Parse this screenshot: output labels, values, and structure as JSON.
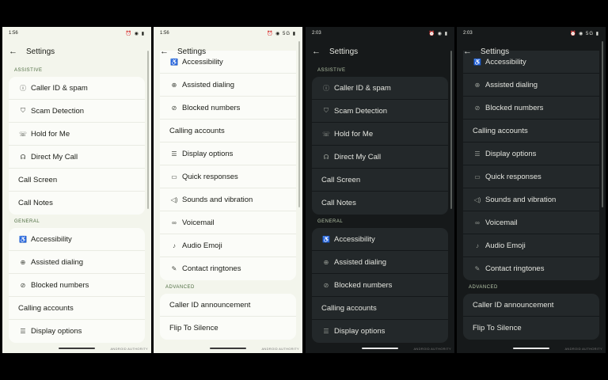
{
  "screens": [
    {
      "theme": "light",
      "time": "1:56",
      "status_icons": "⏰ ◉ ▮",
      "title": "Settings",
      "sections": [
        {
          "header": "ASSISTIVE",
          "items": [
            {
              "label": "Caller ID & spam",
              "icon": "info-circle-icon",
              "glyph": "ⓘ"
            },
            {
              "label": "Scam Detection",
              "icon": "shield-icon",
              "glyph": "⛉"
            },
            {
              "label": "Hold for Me",
              "icon": "phone-hold-icon",
              "glyph": "☏"
            },
            {
              "label": "Direct My Call",
              "icon": "direct-call-icon",
              "glyph": "☊"
            },
            {
              "label": "Call Screen",
              "icon": "",
              "glyph": ""
            },
            {
              "label": "Call Notes",
              "icon": "",
              "glyph": ""
            }
          ]
        },
        {
          "header": "GENERAL",
          "items": [
            {
              "label": "Accessibility",
              "icon": "accessibility-icon",
              "glyph": "♿"
            },
            {
              "label": "Assisted dialing",
              "icon": "globe-phone-icon",
              "glyph": "⊕"
            },
            {
              "label": "Blocked numbers",
              "icon": "block-icon",
              "glyph": "⊘"
            },
            {
              "label": "Calling accounts",
              "icon": "",
              "glyph": ""
            },
            {
              "label": "Display options",
              "icon": "list-icon",
              "glyph": "☰"
            }
          ]
        }
      ]
    },
    {
      "theme": "light",
      "time": "1:56",
      "status_icons": "⏰ ◉ 5G ▮",
      "title": "Settings",
      "sections": [
        {
          "header": "",
          "items": [
            {
              "label": "Accessibility",
              "icon": "accessibility-icon",
              "glyph": "♿"
            },
            {
              "label": "Assisted dialing",
              "icon": "globe-phone-icon",
              "glyph": "⊕"
            },
            {
              "label": "Blocked numbers",
              "icon": "block-icon",
              "glyph": "⊘"
            },
            {
              "label": "Calling accounts",
              "icon": "",
              "glyph": ""
            },
            {
              "label": "Display options",
              "icon": "list-icon",
              "glyph": "☰"
            },
            {
              "label": "Quick responses",
              "icon": "message-icon",
              "glyph": "▭"
            },
            {
              "label": "Sounds and vibration",
              "icon": "speaker-icon",
              "glyph": "◁)"
            },
            {
              "label": "Voicemail",
              "icon": "voicemail-icon",
              "glyph": "∞"
            },
            {
              "label": "Audio Emoji",
              "icon": "music-note-icon",
              "glyph": "♪"
            },
            {
              "label": "Contact ringtones",
              "icon": "contact-ringtone-icon",
              "glyph": "✎"
            }
          ]
        },
        {
          "header": "ADVANCED",
          "items": [
            {
              "label": "Caller ID announcement",
              "icon": "",
              "glyph": ""
            },
            {
              "label": "Flip To Silence",
              "icon": "",
              "glyph": ""
            }
          ]
        }
      ]
    },
    {
      "theme": "dark",
      "time": "2:03",
      "status_icons": "⏰ ◉ ▮",
      "title": "Settings",
      "sections": [
        {
          "header": "ASSISTIVE",
          "items": [
            {
              "label": "Caller ID & spam",
              "icon": "info-circle-icon",
              "glyph": "ⓘ"
            },
            {
              "label": "Scam Detection",
              "icon": "shield-icon",
              "glyph": "⛉"
            },
            {
              "label": "Hold for Me",
              "icon": "phone-hold-icon",
              "glyph": "☏"
            },
            {
              "label": "Direct My Call",
              "icon": "direct-call-icon",
              "glyph": "☊"
            },
            {
              "label": "Call Screen",
              "icon": "",
              "glyph": ""
            },
            {
              "label": "Call Notes",
              "icon": "",
              "glyph": ""
            }
          ]
        },
        {
          "header": "GENERAL",
          "items": [
            {
              "label": "Accessibility",
              "icon": "accessibility-icon",
              "glyph": "♿"
            },
            {
              "label": "Assisted dialing",
              "icon": "globe-phone-icon",
              "glyph": "⊕"
            },
            {
              "label": "Blocked numbers",
              "icon": "block-icon",
              "glyph": "⊘"
            },
            {
              "label": "Calling accounts",
              "icon": "",
              "glyph": ""
            },
            {
              "label": "Display options",
              "icon": "list-icon",
              "glyph": "☰"
            }
          ]
        }
      ]
    },
    {
      "theme": "dark",
      "time": "2:03",
      "status_icons": "⏰ ◉ 5G ▮",
      "title": "Settings",
      "sections": [
        {
          "header": "",
          "items": [
            {
              "label": "Accessibility",
              "icon": "accessibility-icon",
              "glyph": "♿"
            },
            {
              "label": "Assisted dialing",
              "icon": "globe-phone-icon",
              "glyph": "⊕"
            },
            {
              "label": "Blocked numbers",
              "icon": "block-icon",
              "glyph": "⊘"
            },
            {
              "label": "Calling accounts",
              "icon": "",
              "glyph": ""
            },
            {
              "label": "Display options",
              "icon": "list-icon",
              "glyph": "☰"
            },
            {
              "label": "Quick responses",
              "icon": "message-icon",
              "glyph": "▭"
            },
            {
              "label": "Sounds and vibration",
              "icon": "speaker-icon",
              "glyph": "◁)"
            },
            {
              "label": "Voicemail",
              "icon": "voicemail-icon",
              "glyph": "∞"
            },
            {
              "label": "Audio Emoji",
              "icon": "music-note-icon",
              "glyph": "♪"
            },
            {
              "label": "Contact ringtones",
              "icon": "contact-ringtone-icon",
              "glyph": "✎"
            }
          ]
        },
        {
          "header": "ADVANCED",
          "items": [
            {
              "label": "Caller ID announcement",
              "icon": "",
              "glyph": ""
            },
            {
              "label": "Flip To Silence",
              "icon": "",
              "glyph": ""
            }
          ]
        }
      ]
    }
  ],
  "watermark": "ANDROID AUTHORITY"
}
